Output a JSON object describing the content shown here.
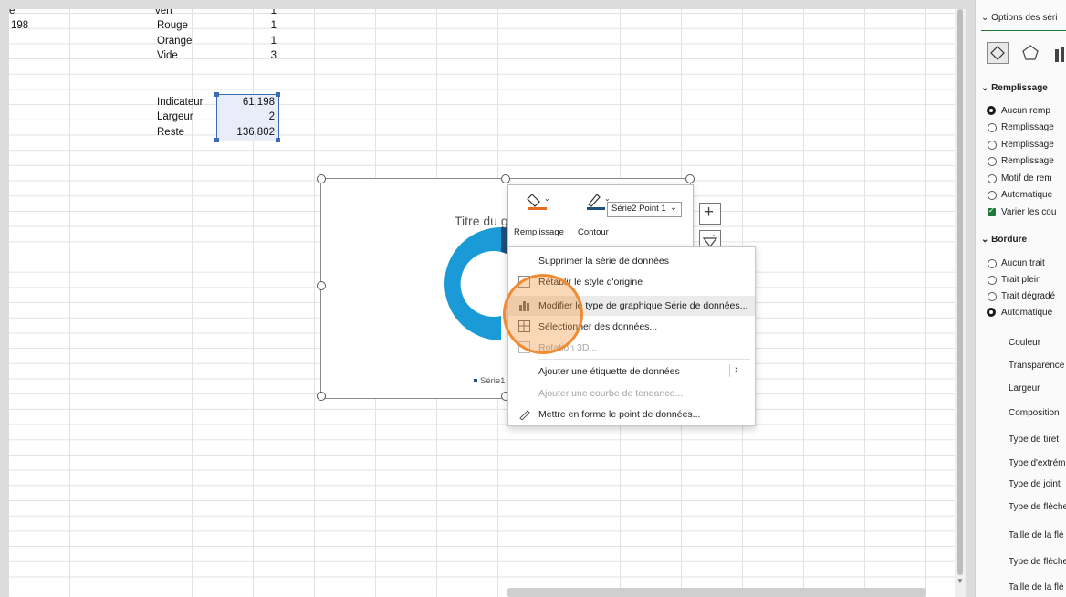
{
  "sheet": {
    "col_a_value": "198",
    "top_partial": "vert",
    "top_partial_num": "1",
    "list": [
      {
        "label": "Rouge",
        "value": "1"
      },
      {
        "label": "Orange",
        "value": "1"
      },
      {
        "label": "Vide",
        "value": "3"
      }
    ],
    "table": [
      {
        "label": "Indicateur",
        "value": "61,198"
      },
      {
        "label": "Largeur",
        "value": "2"
      },
      {
        "label": "Reste",
        "value": "136,802"
      }
    ]
  },
  "chart": {
    "title": "Titre du gr",
    "legend": "Série1",
    "colors": {
      "outer": "#1a9bd7",
      "dark": "#1f4e79"
    }
  },
  "mini_toolbar": {
    "fill_label": "Remplissage",
    "outline_label": "Contour",
    "series_select": "Série2 Point 1",
    "fill_color": "#e36c1e",
    "outline_color": "#1f4e79"
  },
  "context_menu": {
    "items": [
      {
        "label": "Supprimer la série de données",
        "icon": "none",
        "disabled": false
      },
      {
        "label": "Rétablir le style d'origine",
        "icon": "reset-style-icon",
        "disabled": false
      },
      {
        "label": "Modifier le type de graphique Série de données...",
        "icon": "chart-type-icon",
        "disabled": false
      },
      {
        "label": "Sélectionner des données...",
        "icon": "select-data-icon",
        "disabled": false
      },
      {
        "label": "Rotation 3D...",
        "icon": "rotation-3d-icon",
        "disabled": true
      },
      {
        "label": "Ajouter une étiquette de données",
        "icon": "none",
        "disabled": false
      },
      {
        "label": "Ajouter une courbe de tendance...",
        "icon": "none",
        "disabled": true
      },
      {
        "label": "Mettre en forme le point de données...",
        "icon": "format-point-icon",
        "disabled": false
      }
    ]
  },
  "pane": {
    "header": "Options des séri",
    "section_fill": "Remplissage",
    "fill_options": [
      "Aucun remp",
      "Remplissage",
      "Remplissage",
      "Remplissage",
      "Motif de rem",
      "Automatique"
    ],
    "vary_colors": "Varier les cou",
    "section_border": "Bordure",
    "border_options": [
      "Aucun trait",
      "Trait plein",
      "Trait dégradé",
      "Automatique"
    ],
    "props": [
      "Couleur",
      "Transparence",
      "Largeur",
      "Composition",
      "Type de tiret",
      "Type d'extrém",
      "Type de joint",
      "Type de flèche",
      "Taille de la flè",
      "Type de flèche",
      "Taille de la flè"
    ]
  }
}
